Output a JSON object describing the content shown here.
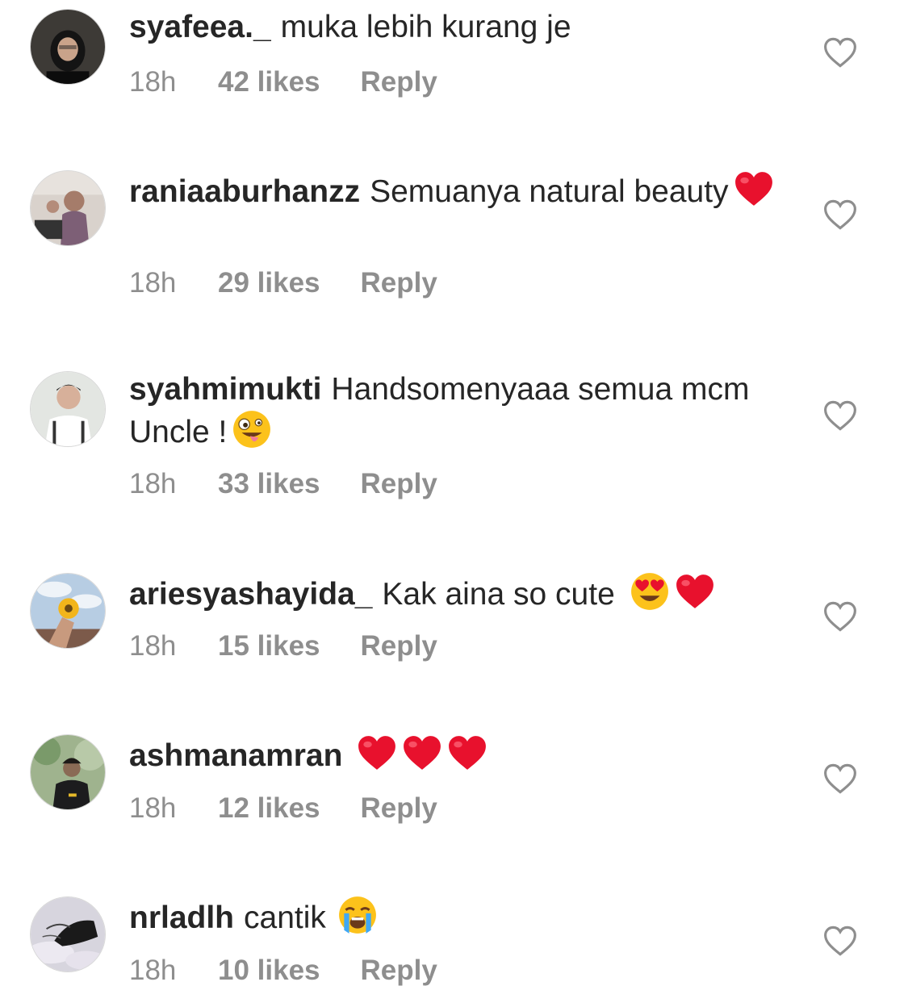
{
  "comments": [
    {
      "username": "syafeea._",
      "text": "muka lebih kurang je",
      "time": "18h",
      "likes": "42 likes",
      "reply": "Reply",
      "emojis": []
    },
    {
      "username": "raniaaburhanzz",
      "text": "Semuanya natural beauty",
      "time": "18h",
      "likes": "29 likes",
      "reply": "Reply",
      "emojis": [
        "red-heart-emoji"
      ]
    },
    {
      "username": "syahmimukti",
      "text": "Handsomenyaaa semua mcm Uncle !",
      "time": "18h",
      "likes": "33 likes",
      "reply": "Reply",
      "emojis": [
        "zany-face-emoji"
      ]
    },
    {
      "username": "ariesyashayida_",
      "text": "Kak aina so cute",
      "time": "18h",
      "likes": "15 likes",
      "reply": "Reply",
      "emojis": [
        "heart-eyes-emoji",
        "red-heart-emoji"
      ]
    },
    {
      "username": "ashmanamran",
      "text": "",
      "time": "18h",
      "likes": "12 likes",
      "reply": "Reply",
      "emojis": [
        "red-heart-emoji",
        "red-heart-emoji",
        "red-heart-emoji"
      ]
    },
    {
      "username": "nrladlh",
      "text": "cantik",
      "time": "18h",
      "likes": "10 likes",
      "reply": "Reply",
      "emojis": [
        "loudly-crying-emoji"
      ]
    }
  ],
  "colors": {
    "text": "#262626",
    "meta": "#8e8e8e",
    "heart_outline": "#8e8e8e",
    "emoji_heart": "#e8112d"
  },
  "icons": {
    "like": "heart-outline-icon"
  }
}
